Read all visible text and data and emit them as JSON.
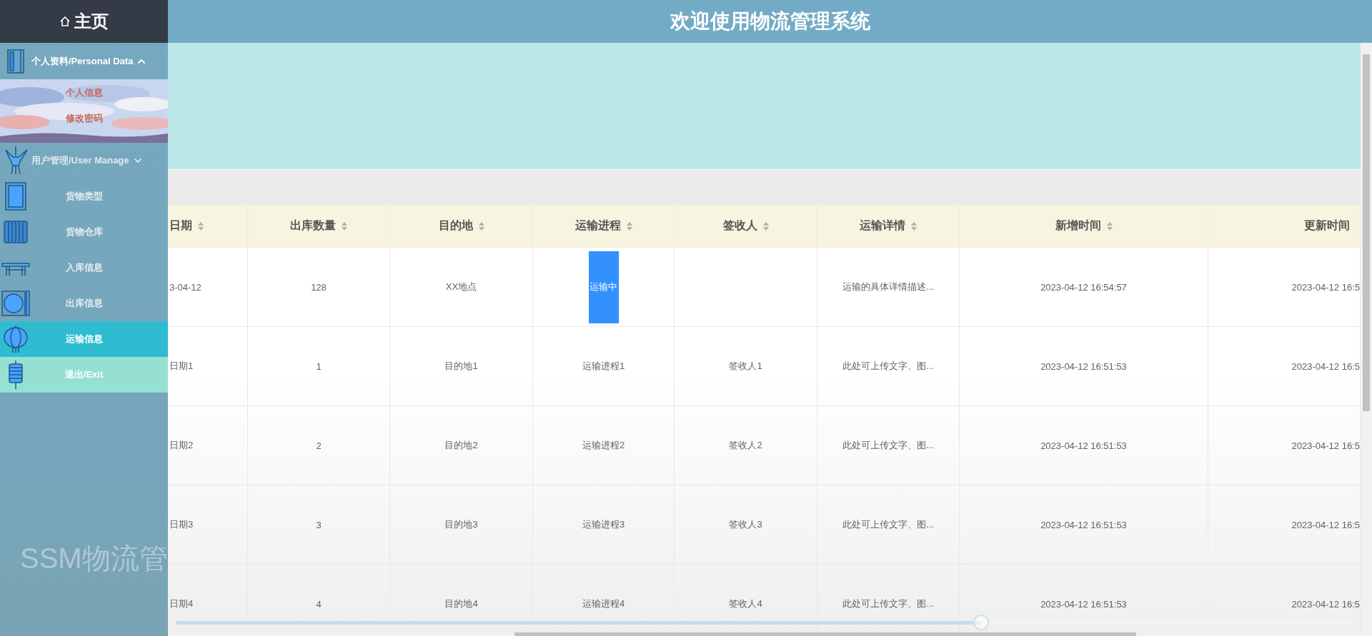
{
  "header": {
    "title": "欢迎使用物流管理系统"
  },
  "sidebar": {
    "home": "主页",
    "bg_text": "SSM物流管",
    "menu": [
      {
        "label": "个人资料/Personal Data",
        "kind": "group",
        "expanded": true,
        "children": [
          {
            "label": "个人信息"
          },
          {
            "label": "修改密码"
          }
        ]
      },
      {
        "label": "用户管理/User Manage",
        "kind": "group",
        "expanded": false
      },
      {
        "label": "货物类型",
        "kind": "item",
        "selected": false
      },
      {
        "label": "货物仓库",
        "kind": "item",
        "selected": false
      },
      {
        "label": "入库信息",
        "kind": "item",
        "selected": false
      },
      {
        "label": "出库信息",
        "kind": "item",
        "selected": false
      },
      {
        "label": "运输信息",
        "kind": "item",
        "selected": true
      },
      {
        "label": "退出/Exit",
        "kind": "exit"
      }
    ]
  },
  "table": {
    "columns": [
      {
        "label": "日期",
        "sortable": true
      },
      {
        "label": "出库数量",
        "sortable": true
      },
      {
        "label": "目的地",
        "sortable": true
      },
      {
        "label": "运输进程",
        "sortable": true
      },
      {
        "label": "签收人",
        "sortable": true
      },
      {
        "label": "运输详情",
        "sortable": true
      },
      {
        "label": "新增时间",
        "sortable": true
      },
      {
        "label": "更新时间",
        "sortable": false
      }
    ],
    "rows": [
      {
        "cells": [
          "3-04-12",
          "128",
          "XX地点",
          {
            "kind": "tag",
            "text": "运输中"
          },
          null,
          "运输的具体详情描述...",
          "2023-04-12 16:54:57",
          "2023-04-12 16:5"
        ]
      },
      {
        "cells": [
          "日期1",
          "1",
          "目的地1",
          "运输进程1",
          "签收人1",
          "此处可上传文字、图...",
          "2023-04-12 16:51:53",
          "2023-04-12 16:5"
        ]
      },
      {
        "cells": [
          "日期2",
          "2",
          "目的地2",
          "运输进程2",
          "签收人2",
          "此处可上传文字、图...",
          "2023-04-12 16:51:53",
          "2023-04-12 16:5"
        ]
      },
      {
        "cells": [
          "日期3",
          "3",
          "目的地3",
          "运输进程3",
          "签收人3",
          "此处可上传文字、图...",
          "2023-04-12 16:51:53",
          "2023-04-12 16:5"
        ]
      },
      {
        "cells": [
          "日期4",
          "4",
          "目的地4",
          "运输进程4",
          "签收人4",
          "此处可上传文字、图...",
          "2023-04-12 16:51:53",
          "2023-04-12 16:5"
        ]
      }
    ]
  },
  "slider": {
    "level": 0.684
  }
}
